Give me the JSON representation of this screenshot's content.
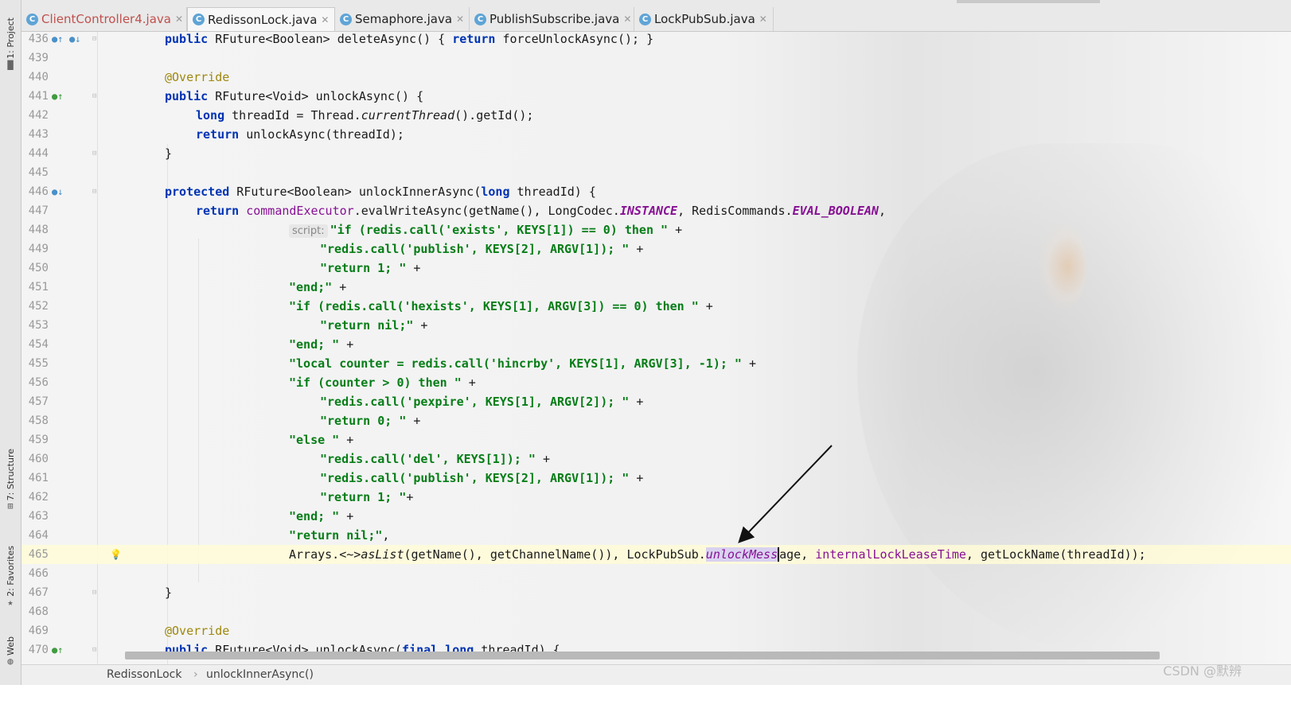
{
  "side_panels": [
    {
      "label": "1: Project",
      "icon": "folder-icon"
    },
    {
      "label": "7: Structure",
      "icon": "structure-icon"
    },
    {
      "label": "2: Favorites",
      "icon": "star-icon"
    },
    {
      "label": "Web",
      "icon": "web-icon"
    }
  ],
  "tabs": [
    {
      "name": "ClientController4.java",
      "color": "#c0504d",
      "active": false
    },
    {
      "name": "RedissonLock.java",
      "color": "#222222",
      "active": true
    },
    {
      "name": "Semaphore.java",
      "color": "#222222",
      "active": false
    },
    {
      "name": "PublishSubscribe.java",
      "color": "#222222",
      "active": false
    },
    {
      "name": "LockPubSub.java",
      "color": "#222222",
      "active": false
    }
  ],
  "tab_icon_glyph": "C",
  "tab_close_glyph": "✕",
  "lines": [
    {
      "n": "436",
      "indent": 1,
      "tokens": [
        [
          "kw",
          "public"
        ],
        [
          "t",
          " RFuture<Boolean> deleteAsync() { "
        ],
        [
          "kw",
          "return"
        ],
        [
          "t",
          " forceUnlockAsync(); }"
        ]
      ]
    },
    {
      "n": "439",
      "indent": 0,
      "tokens": []
    },
    {
      "n": "440",
      "indent": 1,
      "tokens": [
        [
          "ann",
          "@Override"
        ]
      ]
    },
    {
      "n": "441",
      "indent": 1,
      "tokens": [
        [
          "kw",
          "public"
        ],
        [
          "t",
          " RFuture<Void> unlockAsync() {"
        ]
      ]
    },
    {
      "n": "442",
      "indent": 2,
      "tokens": [
        [
          "kw",
          "long"
        ],
        [
          "t",
          " threadId = Thread."
        ],
        [
          "ital",
          "currentThread"
        ],
        [
          "t",
          "().getId();"
        ]
      ]
    },
    {
      "n": "443",
      "indent": 2,
      "tokens": [
        [
          "kw",
          "return"
        ],
        [
          "t",
          " unlockAsync(threadId);"
        ]
      ]
    },
    {
      "n": "444",
      "indent": 1,
      "tokens": [
        [
          "t",
          "}"
        ]
      ]
    },
    {
      "n": "445",
      "indent": 0,
      "tokens": []
    },
    {
      "n": "446",
      "indent": 1,
      "tokens": [
        [
          "kw",
          "protected"
        ],
        [
          "t",
          " RFuture<Boolean> unlockInnerAsync("
        ],
        [
          "kw",
          "long"
        ],
        [
          "t",
          " threadId) {"
        ]
      ]
    },
    {
      "n": "447",
      "indent": 2,
      "tokens": [
        [
          "kw",
          "return"
        ],
        [
          "t",
          " "
        ],
        [
          "field",
          "commandExecutor"
        ],
        [
          "t",
          ".evalWriteAsync(getName(), LongCodec."
        ],
        [
          "const",
          "INSTANCE"
        ],
        [
          "t",
          ", RedisCommands."
        ],
        [
          "const",
          "EVAL_BOOLEAN"
        ],
        [
          "t",
          ","
        ]
      ]
    },
    {
      "n": "448",
      "indent": 5,
      "tokens": [
        [
          "hint",
          "script:"
        ],
        [
          "str",
          "\"if (redis.call('exists', KEYS[1]) == 0) then \""
        ],
        [
          "t",
          " +"
        ]
      ]
    },
    {
      "n": "449",
      "indent": 6,
      "tokens": [
        [
          "str",
          "\"redis.call('publish', KEYS[2], ARGV[1]); \""
        ],
        [
          "t",
          " +"
        ]
      ]
    },
    {
      "n": "450",
      "indent": 6,
      "tokens": [
        [
          "str",
          "\"return 1; \""
        ],
        [
          "t",
          " +"
        ]
      ]
    },
    {
      "n": "451",
      "indent": 5,
      "tokens": [
        [
          "str",
          "\"end;\""
        ],
        [
          "t",
          " +"
        ]
      ]
    },
    {
      "n": "452",
      "indent": 5,
      "tokens": [
        [
          "str",
          "\"if (redis.call('hexists', KEYS[1], ARGV[3]) == 0) then \""
        ],
        [
          "t",
          " +"
        ]
      ]
    },
    {
      "n": "453",
      "indent": 6,
      "tokens": [
        [
          "str",
          "\"return nil;\""
        ],
        [
          "t",
          " +"
        ]
      ]
    },
    {
      "n": "454",
      "indent": 5,
      "tokens": [
        [
          "str",
          "\"end; \""
        ],
        [
          "t",
          " +"
        ]
      ]
    },
    {
      "n": "455",
      "indent": 5,
      "tokens": [
        [
          "str",
          "\"local counter = redis.call('hincrby', KEYS[1], ARGV[3], -1); \""
        ],
        [
          "t",
          " +"
        ]
      ]
    },
    {
      "n": "456",
      "indent": 5,
      "tokens": [
        [
          "str",
          "\"if (counter > 0) then \""
        ],
        [
          "t",
          " +"
        ]
      ]
    },
    {
      "n": "457",
      "indent": 6,
      "tokens": [
        [
          "str",
          "\"redis.call('pexpire', KEYS[1], ARGV[2]); \""
        ],
        [
          "t",
          " +"
        ]
      ]
    },
    {
      "n": "458",
      "indent": 6,
      "tokens": [
        [
          "str",
          "\"return 0; \""
        ],
        [
          "t",
          " +"
        ]
      ]
    },
    {
      "n": "459",
      "indent": 5,
      "tokens": [
        [
          "str",
          "\"else \""
        ],
        [
          "t",
          " +"
        ]
      ]
    },
    {
      "n": "460",
      "indent": 6,
      "tokens": [
        [
          "str",
          "\"redis.call('del', KEYS[1]); \""
        ],
        [
          "t",
          " +"
        ]
      ]
    },
    {
      "n": "461",
      "indent": 6,
      "tokens": [
        [
          "str",
          "\"redis.call('publish', KEYS[2], ARGV[1]); \""
        ],
        [
          "t",
          " +"
        ]
      ]
    },
    {
      "n": "462",
      "indent": 6,
      "tokens": [
        [
          "str",
          "\"return 1; \""
        ],
        [
          "t",
          "+"
        ]
      ]
    },
    {
      "n": "463",
      "indent": 5,
      "tokens": [
        [
          "str",
          "\"end; \""
        ],
        [
          "t",
          " +"
        ]
      ]
    },
    {
      "n": "464",
      "indent": 5,
      "tokens": [
        [
          "str",
          "\"return nil;\""
        ],
        [
          "t",
          ","
        ]
      ]
    },
    {
      "n": "465",
      "indent": 5,
      "current": true,
      "tokens": [
        [
          "t",
          "Arrays."
        ],
        [
          "t",
          "<~>"
        ],
        [
          "ital",
          "asList"
        ],
        [
          "t",
          "(getName(), getChannelName()), LockPubSub."
        ],
        [
          "sel",
          "unlockMess"
        ],
        [
          "caret",
          "age"
        ],
        [
          "t",
          ", "
        ],
        [
          "field",
          "internalLockLeaseTime"
        ],
        [
          "t",
          ", getLockName(threadId));"
        ]
      ]
    },
    {
      "n": "466",
      "indent": 0,
      "tokens": []
    },
    {
      "n": "467",
      "indent": 1,
      "tokens": [
        [
          "t",
          "}"
        ]
      ]
    },
    {
      "n": "468",
      "indent": 0,
      "tokens": []
    },
    {
      "n": "469",
      "indent": 1,
      "tokens": [
        [
          "ann",
          "@Override"
        ]
      ]
    },
    {
      "n": "470",
      "indent": 1,
      "tokens": [
        [
          "kw",
          "public"
        ],
        [
          "t",
          " RFuture<Void> unlockAsync("
        ],
        [
          "kw",
          "final"
        ],
        [
          "t",
          " "
        ],
        [
          "kw",
          "long"
        ],
        [
          "t",
          " threadId) {"
        ]
      ]
    }
  ],
  "gutter_icons": {
    "436": [
      "override-up-icon",
      "implemented-down-icon"
    ],
    "441": [
      "implements-icon"
    ],
    "446": [
      "overridden-down-icon"
    ],
    "465": [
      "lightbulb-icon"
    ],
    "470": [
      "implements-icon"
    ]
  },
  "fold_markers": [
    "436",
    "441",
    "444",
    "446",
    "467",
    "470"
  ],
  "breadcrumb": [
    "RedissonLock",
    "unlockInnerAsync()"
  ],
  "breadcrumb_sep": "›",
  "watermark": "CSDN @默辨"
}
